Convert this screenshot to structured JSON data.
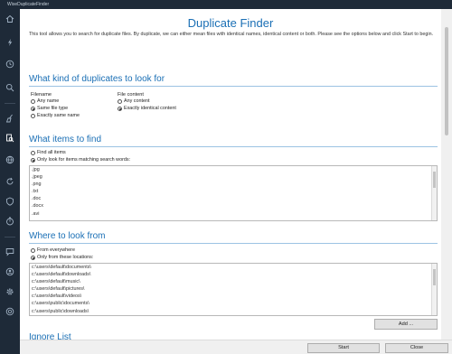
{
  "window": {
    "title": "WiseDuplicateFinder"
  },
  "sidebar": {
    "icons": [
      "home-icon",
      "flash-icon",
      "clock-icon",
      "search-icon",
      "broom-icon",
      "search-file-icon",
      "globe-icon",
      "refresh-icon",
      "shield-icon",
      "timer-icon",
      "chat-icon",
      "user-icon",
      "gear-icon",
      "help-icon"
    ]
  },
  "page": {
    "title": "Duplicate Finder",
    "intro": "This tool allows you to search for duplicate files. By duplicate, we can either mean files with identical names, identical content or both. Please see the options below and click Start to begin."
  },
  "kinds": {
    "heading": "What kind of duplicates to look for",
    "filename": {
      "label": "Filename",
      "options": [
        {
          "label": "Any name",
          "selected": false
        },
        {
          "label": "Same file type",
          "selected": true
        },
        {
          "label": "Exactly same name",
          "selected": false
        }
      ]
    },
    "content": {
      "label": "File content",
      "options": [
        {
          "label": "Any content",
          "selected": false
        },
        {
          "label": "Exactly identical content",
          "selected": true
        }
      ]
    }
  },
  "items": {
    "heading": "What items to find",
    "options": [
      {
        "label": "Find all items",
        "selected": false
      },
      {
        "label": "Only look for items matching search words:",
        "selected": true
      }
    ],
    "words": [
      ".jpg",
      ".jpeg",
      ".png",
      ".txt",
      ".doc",
      ".docx",
      ".avi"
    ]
  },
  "where": {
    "heading": "Where to look from",
    "options": [
      {
        "label": "From everywhere",
        "selected": false
      },
      {
        "label": "Only from these locations:",
        "selected": true
      }
    ],
    "locations": [
      "c:\\users\\default\\documents\\",
      "c:\\users\\default\\downloads\\",
      "c:\\users\\default\\music\\",
      "c:\\users\\default\\pictures\\",
      "c:\\users\\default\\videos\\",
      "c:\\users\\public\\documents\\",
      "c:\\users\\public\\downloads\\"
    ],
    "add_label": "Add ..."
  },
  "ignore": {
    "heading": "Ignore List"
  },
  "footer": {
    "start_label": "Start",
    "close_label": "Close"
  }
}
